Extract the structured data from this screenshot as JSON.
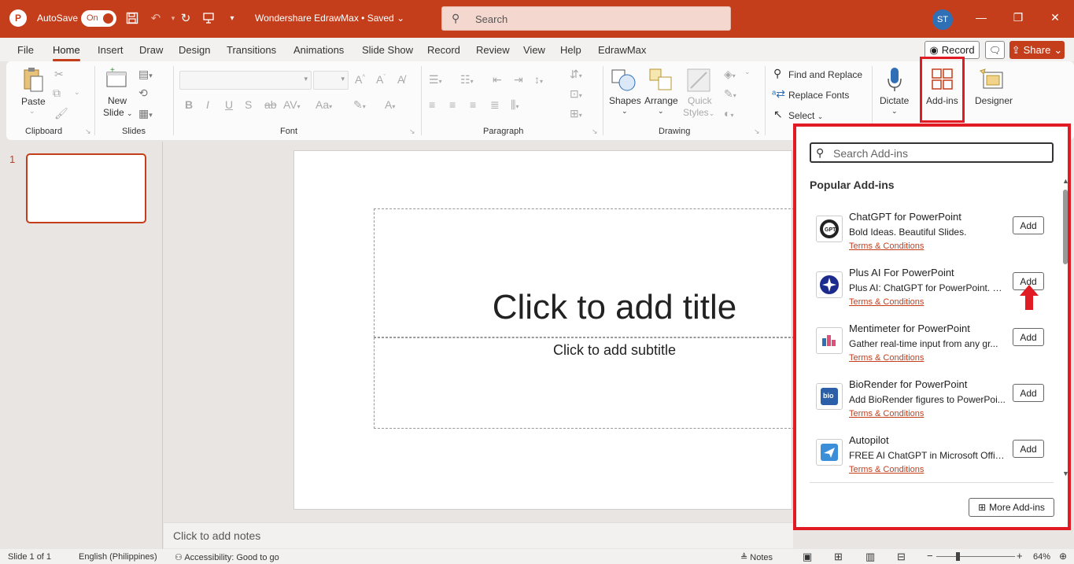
{
  "titlebar": {
    "app_logo": "P",
    "autosave_label": "AutoSave",
    "autosave_state": "On",
    "doc_title": "Wondershare EdrawMax • Saved",
    "search_placeholder": "Search",
    "avatar_initials": "ST"
  },
  "menu": {
    "tabs": [
      "File",
      "Home",
      "Insert",
      "Draw",
      "Design",
      "Transitions",
      "Animations",
      "Slide Show",
      "Record",
      "Review",
      "View",
      "Help",
      "EdrawMax"
    ],
    "active_tab": "Home",
    "record_label": "Record",
    "share_label": "Share"
  },
  "ribbon": {
    "paste": "Paste",
    "new_slide": "New",
    "new_slide_2": "Slide",
    "clipboard": "Clipboard",
    "slides": "Slides",
    "font": "Font",
    "paragraph": "Paragraph",
    "drawing": "Drawing",
    "shapes": "Shapes",
    "arrange": "Arrange",
    "quick": "Quick",
    "styles": "Styles",
    "find_replace": "Find and Replace",
    "replace_fonts": "Replace Fonts",
    "select": "Select",
    "dictate": "Dictate",
    "addins": "Add-ins",
    "designer": "Designer"
  },
  "slides_panel": {
    "slide_number": "1"
  },
  "slide": {
    "title_placeholder": "Click to add title",
    "subtitle_placeholder": "Click to add subtitle",
    "notes_placeholder": "Click to add notes"
  },
  "statusbar": {
    "slide_info": "Slide 1 of 1",
    "language": "English (Philippines)",
    "accessibility": "Accessibility: Good to go",
    "notes_label": "Notes",
    "zoom": "64%"
  },
  "addins_pane": {
    "search_placeholder": "Search Add-ins",
    "section_title": "Popular Add-ins",
    "items": [
      {
        "name": "ChatGPT for PowerPoint",
        "desc": "Bold Ideas. Beautiful Slides.",
        "terms": "Terms & Conditions",
        "add": "Add",
        "logo": "GPT"
      },
      {
        "name": "Plus AI For PowerPoint",
        "desc": "Plus AI: ChatGPT for PowerPoint. C...",
        "terms": "Terms & Conditions",
        "add": "Add",
        "logo": "+"
      },
      {
        "name": "Mentimeter for PowerPoint",
        "desc": "Gather real-time input from any gr...",
        "terms": "Terms & Conditions",
        "add": "Add",
        "logo": "M"
      },
      {
        "name": "BioRender for PowerPoint",
        "desc": "Add BioRender figures to PowerPoi...",
        "terms": "Terms & Conditions",
        "add": "Add",
        "logo": "bio"
      },
      {
        "name": "Autopilot",
        "desc": "FREE AI ChatGPT in Microsoft Offic...",
        "terms": "Terms & Conditions",
        "add": "Add",
        "logo": "✈"
      }
    ],
    "more_label": "More Add-ins"
  },
  "colors": {
    "brand": "#c43e1c",
    "highlight": "#e01b24"
  }
}
